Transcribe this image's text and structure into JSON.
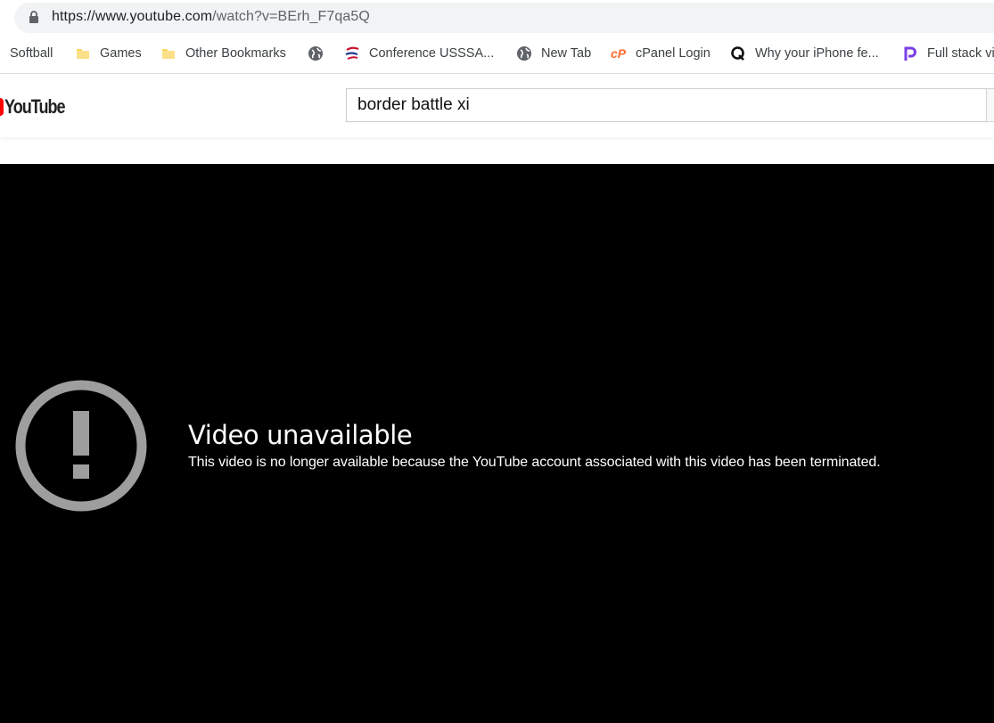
{
  "browser": {
    "url_host": "https://www.youtube.com",
    "url_path": "/watch?v=BErh_F7qa5Q"
  },
  "bookmarks": [
    {
      "label": "Softball",
      "icon": "none"
    },
    {
      "label": "Games",
      "icon": "folder-icon"
    },
    {
      "label": "Other Bookmarks",
      "icon": "folder-icon"
    },
    {
      "label": "",
      "icon": "globe-icon"
    },
    {
      "label": "Conference USSSA...",
      "icon": "usssa-icon"
    },
    {
      "label": "New Tab",
      "icon": "globe-icon"
    },
    {
      "label": "cPanel Login",
      "icon": "cpanel-icon"
    },
    {
      "label": "Why your iPhone fe...",
      "icon": "quora-icon"
    },
    {
      "label": "Full stack vi",
      "icon": "p-logo-icon"
    }
  ],
  "youtube": {
    "logo_text": "YouTube",
    "search_value": "border battle xi"
  },
  "player": {
    "error_title": "Video unavailable",
    "error_message": "This video is no longer available because the YouTube account associated with this video has been terminated."
  },
  "colors": {
    "brand_red": "#ff0000",
    "folder_yellow": "#fdd663",
    "cpanel_orange": "#ff6c2c",
    "error_icon_gray": "#9e9e9e"
  }
}
